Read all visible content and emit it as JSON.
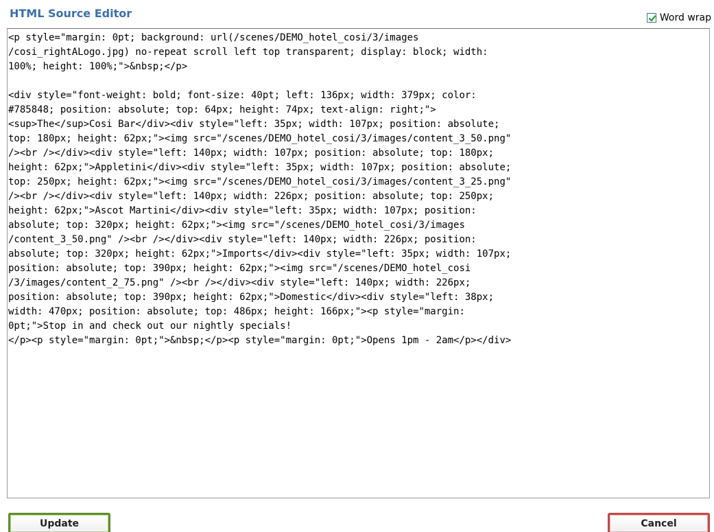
{
  "header": {
    "title": "HTML Source Editor",
    "word_wrap_label": "Word wrap",
    "word_wrap_checked": true
  },
  "editor": {
    "lines": [
      "<p style=\"margin: 0pt; background: url(/scenes/DEMO_hotel_cosi/3/images",
      "/cosi_rightALogo.jpg) no-repeat scroll left top transparent; display: block; width:",
      "100%; height: 100%;\">&nbsp;</p>",
      "",
      "<div style=\"font-weight: bold; font-size: 40pt; left: 136px; width: 379px; color:",
      "#785848; position: absolute; top: 64px; height: 74px; text-align: right;\">",
      "<sup>The</sup>Cosi Bar</div><div style=\"left: 35px; width: 107px; position: absolute;",
      "top: 180px; height: 62px;\"><img src=\"/scenes/DEMO_hotel_cosi/3/images/content_3_50.png\"",
      "/><br /></div><div style=\"left: 140px; width: 107px; position: absolute; top: 180px;",
      "height: 62px;\">Appletini</div><div style=\"left: 35px; width: 107px; position: absolute;",
      "top: 250px; height: 62px;\"><img src=\"/scenes/DEMO_hotel_cosi/3/images/content_3_25.png\"",
      "/><br /></div><div style=\"left: 140px; width: 226px; position: absolute; top: 250px;",
      "height: 62px;\">Ascot Martini</div><div style=\"left: 35px; width: 107px; position:",
      "absolute; top: 320px; height: 62px;\"><img src=\"/scenes/DEMO_hotel_cosi/3/images",
      "/content_3_50.png\" /><br /></div><div style=\"left: 140px; width: 226px; position:",
      "absolute; top: 320px; height: 62px;\">Imports</div><div style=\"left: 35px; width: 107px;",
      "position: absolute; top: 390px; height: 62px;\"><img src=\"/scenes/DEMO_hotel_cosi",
      "/3/images/content_2_75.png\" /><br /></div><div style=\"left: 140px; width: 226px;",
      "position: absolute; top: 390px; height: 62px;\">Domestic</div><div style=\"left: 38px;",
      "width: 470px; position: absolute; top: 486px; height: 166px;\"><p style=\"margin:",
      "0pt;\">Stop in and check out our nightly specials!",
      "</p><p style=\"margin: 0pt;\">&nbsp;</p><p style=\"margin: 0pt;\">Opens 1pm - 2am</p></div>"
    ]
  },
  "buttons": {
    "update_label": "Update",
    "cancel_label": "Cancel"
  },
  "colors": {
    "title": "#3a6fb0",
    "update_border": "#5f8f2c",
    "cancel_border": "#c14a4a"
  }
}
